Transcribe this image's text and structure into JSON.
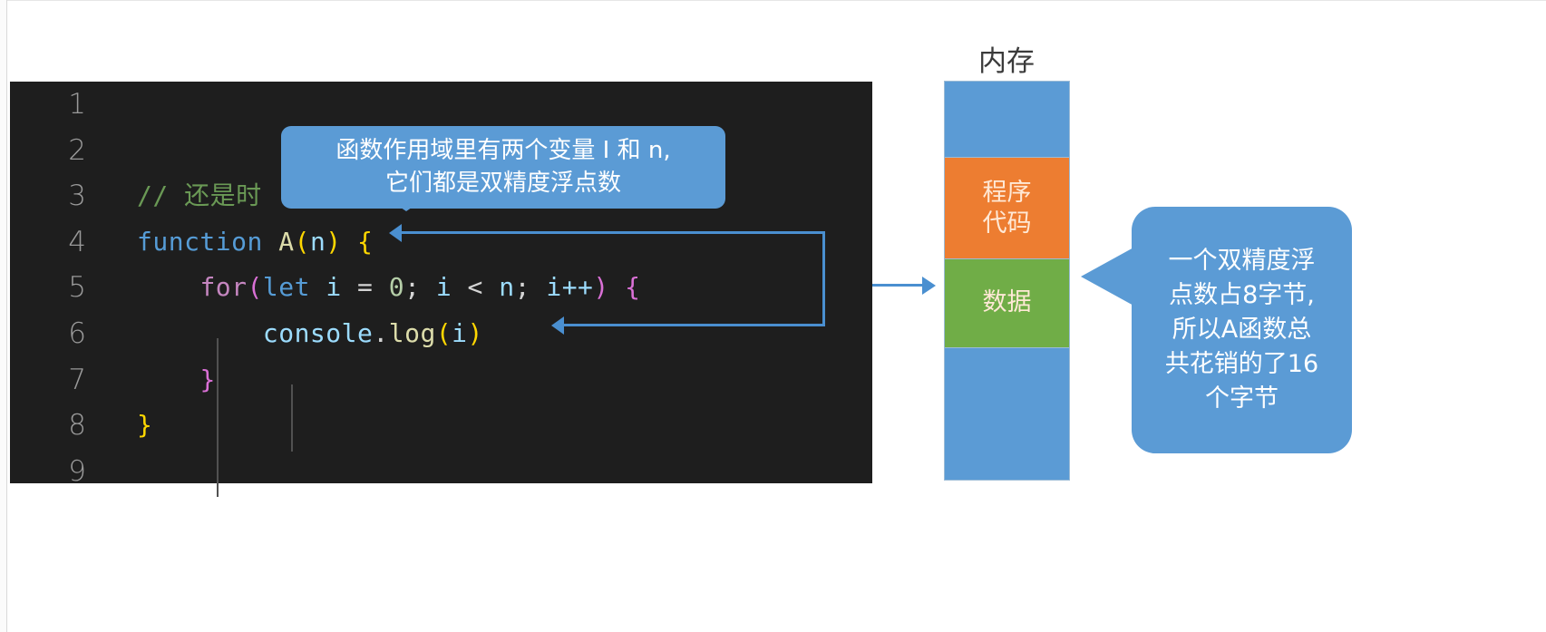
{
  "editor": {
    "background_color": "#1e1e1e",
    "line_numbers": [
      "1",
      "2",
      "3",
      "4",
      "5",
      "6",
      "7",
      "8",
      "9"
    ],
    "lines": [
      {
        "n": "1",
        "text": ""
      },
      {
        "n": "2",
        "text": ""
      },
      {
        "n": "3",
        "text": "// 还是时"
      },
      {
        "n": "4",
        "text": "function A(n) {"
      },
      {
        "n": "5",
        "text": "    for(let i = 0; i < n; i++) {"
      },
      {
        "n": "6",
        "text": "        console.log(i)"
      },
      {
        "n": "7",
        "text": "    }"
      },
      {
        "n": "8",
        "text": "}"
      },
      {
        "n": "9",
        "text": ""
      }
    ],
    "tokens": {
      "comment_slashes": "// ",
      "comment_text": "还是时",
      "kw_function": "function",
      "fn_name": "A",
      "paren_open": "(",
      "param_n": "n",
      "paren_close": ")",
      "brace_open": "{",
      "brace_close": "}",
      "kw_for": "for",
      "kw_let": "let",
      "var_i": "i",
      "op_assign": "=",
      "num_zero": "0",
      "semi": ";",
      "op_lt": "<",
      "var_n": "n",
      "op_incr": "i++",
      "obj_console": "console",
      "dot": ".",
      "prop_log": "log"
    },
    "colors": {
      "comment": "#6a9955",
      "keyword": "#569cd6",
      "function": "#dcdcaa",
      "control": "#c586c0",
      "variable": "#9cdcfe",
      "number": "#b5cea8",
      "punctuation": "#d4d4d4",
      "line_number": "#9a9a9a"
    }
  },
  "tooltip": {
    "line1": "函数作用域里有两个变量 I 和 n,",
    "line2": "它们都是双精度浮点数",
    "color": "#5b9bd5"
  },
  "memory": {
    "title": "内存",
    "segments": [
      {
        "label": "",
        "color": "#5b9bd5",
        "name": "free-top"
      },
      {
        "label": "程序\n代码",
        "label_line1": "程序",
        "label_line2": "代码",
        "color": "#ed7d31",
        "name": "program-code"
      },
      {
        "label": "数据",
        "color": "#70ad47",
        "name": "data"
      },
      {
        "label": "",
        "color": "#5b9bd5",
        "name": "free-bottom"
      }
    ]
  },
  "callout": {
    "text": "一个双精度浮点数占8字节,所以A函数总共花销的了16个字节",
    "lines": [
      "一个双精度浮",
      "点数占8字节,",
      "所以A函数总",
      "共花销的了16",
      "个字节"
    ],
    "color": "#5b9bd5"
  },
  "connectors": {
    "color": "#4a8fd0",
    "arrow_icon": "arrow-left-icon",
    "arrow_right_icon": "arrow-right-icon"
  }
}
